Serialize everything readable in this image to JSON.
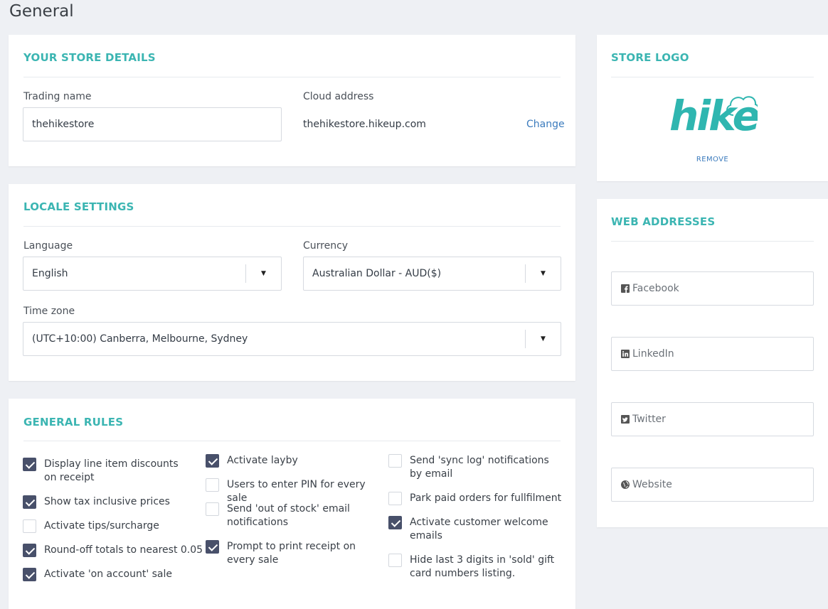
{
  "page": {
    "title": "General"
  },
  "store_details": {
    "title": "YOUR STORE DETAILS",
    "trading_name_label": "Trading name",
    "trading_name_value": "thehikestore",
    "cloud_address_label": "Cloud address",
    "cloud_address_value": "thehikestore.hikeup.com",
    "change_label": "Change"
  },
  "locale": {
    "title": "LOCALE SETTINGS",
    "language_label": "Language",
    "language_value": "English",
    "currency_label": "Currency",
    "currency_value": "Australian Dollar - AUD($)",
    "timezone_label": "Time zone",
    "timezone_value": "(UTC+10:00) Canberra, Melbourne, Sydney",
    "dropdown_glyph": "▼"
  },
  "rules": {
    "title": "GENERAL RULES",
    "items": [
      {
        "label": "Display line item discounts on receipt",
        "checked": true
      },
      {
        "label": "Show tax inclusive prices",
        "checked": true
      },
      {
        "label": "Activate tips/surcharge",
        "checked": false
      },
      {
        "label": "Round-off totals to nearest 0.05",
        "checked": true
      },
      {
        "label": "Activate 'on account' sale",
        "checked": true
      },
      {
        "label": "Activate layby",
        "checked": true
      },
      {
        "label": "Users to enter PIN for every sale",
        "checked": false
      },
      {
        "label": "Send 'out of stock' email notifications",
        "checked": false
      },
      {
        "label": "Prompt to print receipt on every sale",
        "checked": true
      },
      {
        "label": "Send 'sync log' notifications by email",
        "checked": false
      },
      {
        "label": "Park paid orders for fullfilment",
        "checked": false
      },
      {
        "label": "Activate customer welcome emails",
        "checked": true
      },
      {
        "label": "Hide last 3 digits in 'sold' gift card numbers listing.",
        "checked": false
      }
    ]
  },
  "store_logo": {
    "title": "STORE LOGO",
    "logo_text": "hike",
    "brand_color": "#2fb6b0",
    "remove_label": "REMOVE"
  },
  "web_addresses": {
    "title": "WEB ADDRESSES",
    "facebook_placeholder": "Facebook",
    "linkedin_placeholder": "LinkedIn",
    "twitter_placeholder": "Twitter",
    "website_placeholder": "Website"
  },
  "colors": {
    "accent": "#3bb5b2",
    "link": "#3b7bbd",
    "checkbox_checked": "#48506a",
    "background": "#eef0f4"
  }
}
